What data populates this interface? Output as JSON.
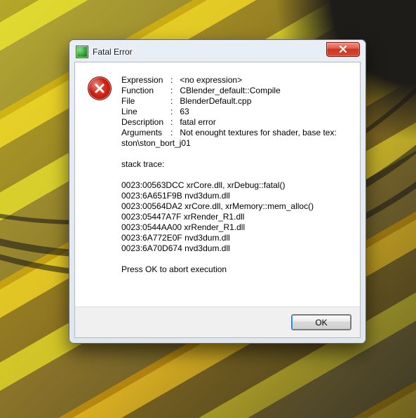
{
  "title": "Fatal Error",
  "icon_name": "app-icon",
  "close_tooltip": "Close",
  "ok_label": "OK",
  "fields": {
    "expression_label": "Expression",
    "expression_value": "<no expression>",
    "function_label": "Function",
    "function_value": "CBlender_default::Compile",
    "file_label": "File",
    "file_value": "BlenderDefault.cpp",
    "line_label": "Line",
    "line_value": "63",
    "description_label": "Description",
    "description_value": "fatal error",
    "arguments_label": "Arguments",
    "arguments_value": "Not enought textures for shader, base tex:",
    "arguments_cont": "ston\\ston_bort_j01"
  },
  "stack_label": "stack trace:",
  "stack": [
    "0023:00563DCC xrCore.dll, xrDebug::fatal()",
    "0023:6A651F9B nvd3dum.dll",
    "0023:00564DA2 xrCore.dll, xrMemory::mem_alloc()",
    "0023:05447A7F xrRender_R1.dll",
    "0023:0544AA00 xrRender_R1.dll",
    "0023:6A772E0F nvd3dum.dll",
    "0023:6A70D674 nvd3dum.dll"
  ],
  "footer": "Press OK to abort execution"
}
